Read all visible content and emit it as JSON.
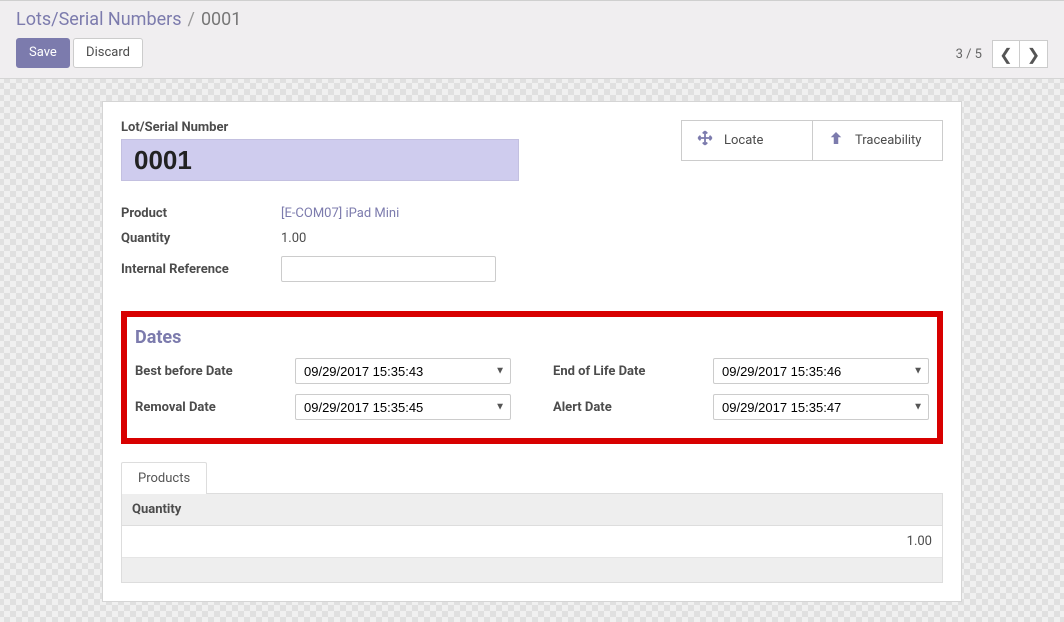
{
  "breadcrumb": {
    "root": "Lots/Serial Numbers",
    "sep": "/",
    "current": "0001"
  },
  "buttons": {
    "save": "Save",
    "discard": "Discard"
  },
  "pager": {
    "text": "3 / 5"
  },
  "stat_buttons": {
    "locate": "Locate",
    "traceability": "Traceability"
  },
  "title": {
    "label": "Lot/Serial Number",
    "value": "0001"
  },
  "fields": {
    "product_label": "Product",
    "product_value": "[E-COM07] iPad Mini",
    "quantity_label": "Quantity",
    "quantity_value": "1.00",
    "internal_ref_label": "Internal Reference",
    "internal_ref_value": ""
  },
  "dates": {
    "heading": "Dates",
    "best_before_label": "Best before Date",
    "best_before_value": "09/29/2017 15:35:43",
    "removal_label": "Removal Date",
    "removal_value": "09/29/2017 15:35:45",
    "eol_label": "End of Life Date",
    "eol_value": "09/29/2017 15:35:46",
    "alert_label": "Alert Date",
    "alert_value": "09/29/2017 15:35:47"
  },
  "tabs": {
    "products": "Products"
  },
  "products_table": {
    "col_quantity": "Quantity",
    "row0_value": "1.00"
  }
}
